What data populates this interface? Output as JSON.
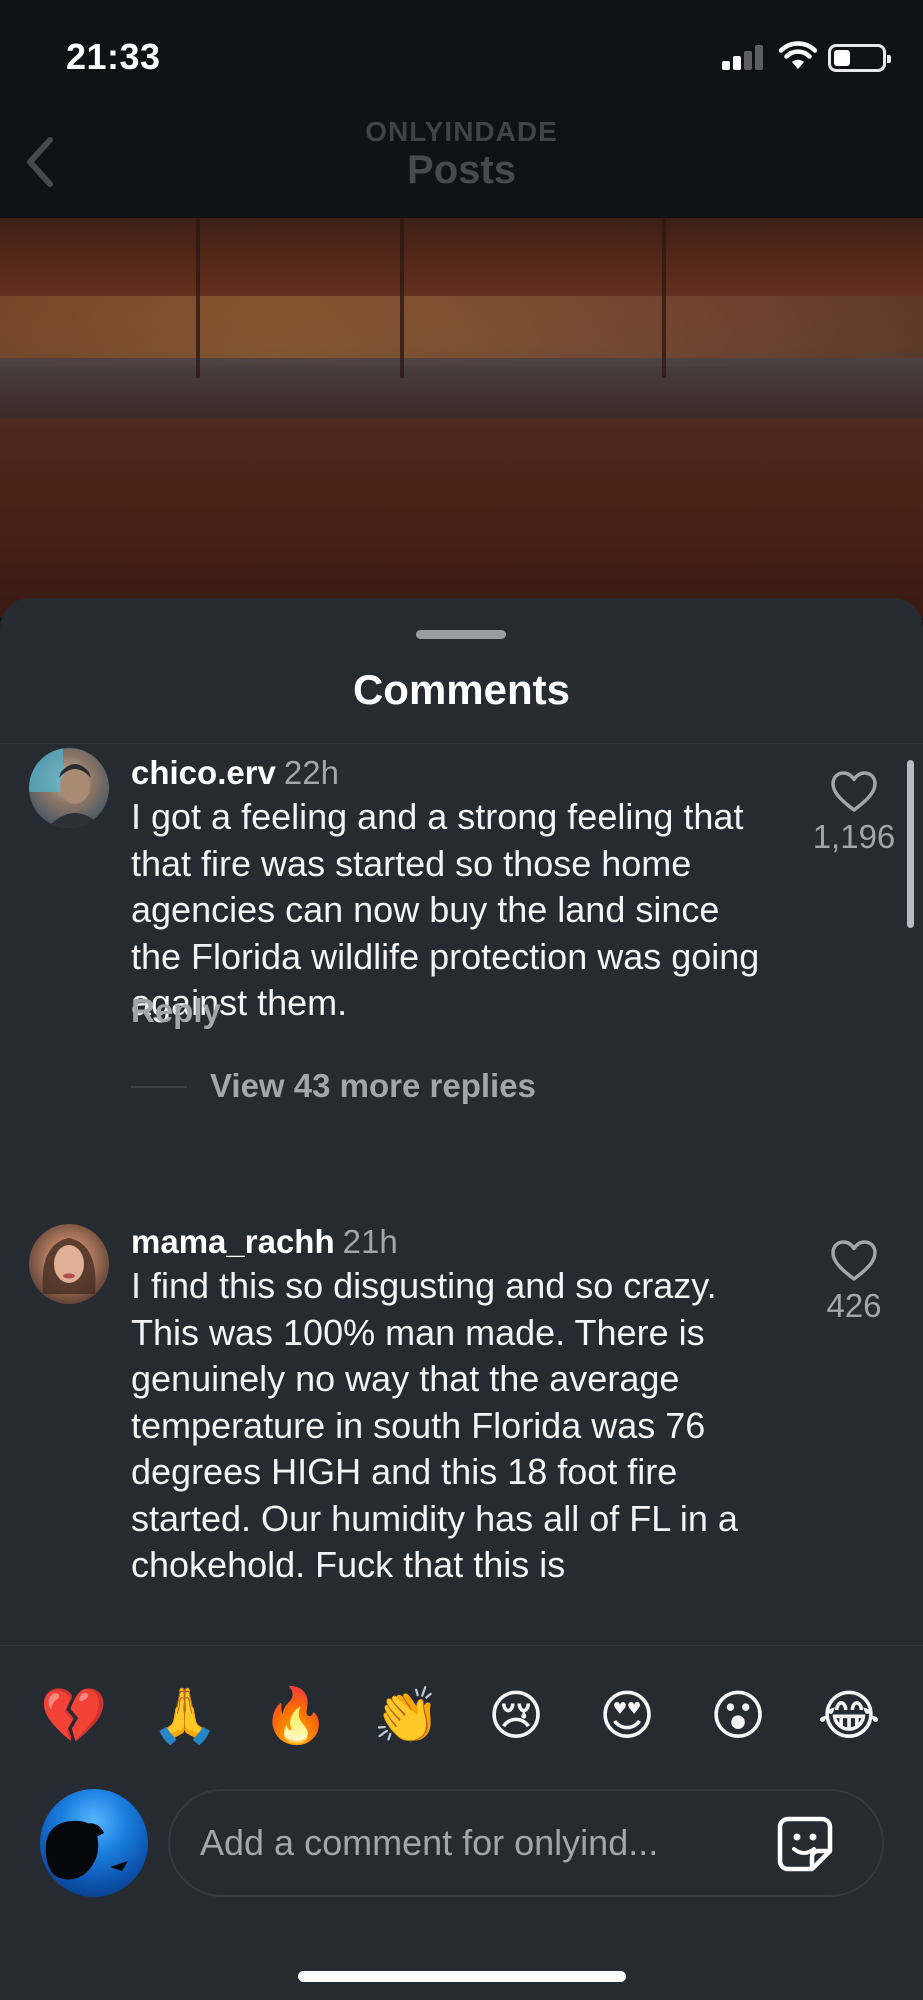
{
  "status_bar": {
    "time": "21:33",
    "signal_icon": "cellular-signal-icon",
    "wifi_icon": "wifi-icon",
    "battery_icon": "battery-icon",
    "battery_level": 0.35
  },
  "header": {
    "account": "ONLYINDADE",
    "title": "Posts",
    "back_icon": "chevron-left-icon"
  },
  "comments_sheet": {
    "title": "Comments",
    "comments": [
      {
        "username": "chico.erv",
        "time": "22h",
        "text": "I got a feeling and a strong feeling that that fire was started so those home agencies can now buy the land since the Florida wildlife protection was going against them.",
        "likes": "1,196",
        "reply_label": "Reply",
        "view_replies_label": "View 43 more replies"
      },
      {
        "username": "mama_rachh",
        "time": "21h",
        "text": "I find this so disgusting and so crazy. This was 100% man made. There is genuinely no way that the average temperature in south Florida was 76 degrees HIGH and this 18 foot fire started. Our humidity has all of FL in a chokehold. Fuck that this is",
        "likes": "426"
      }
    ]
  },
  "emoji_bar": [
    "💔",
    "🙏",
    "🔥",
    "👏",
    "😢",
    "😍",
    "😮",
    "😂"
  ],
  "composer": {
    "placeholder": "Add a comment for onlyind...",
    "sticker_icon": "sticker-icon"
  },
  "colors": {
    "sheet_background": "#262a31",
    "header_background": "#0f1114",
    "secondary_text": "#a2a5ab"
  }
}
